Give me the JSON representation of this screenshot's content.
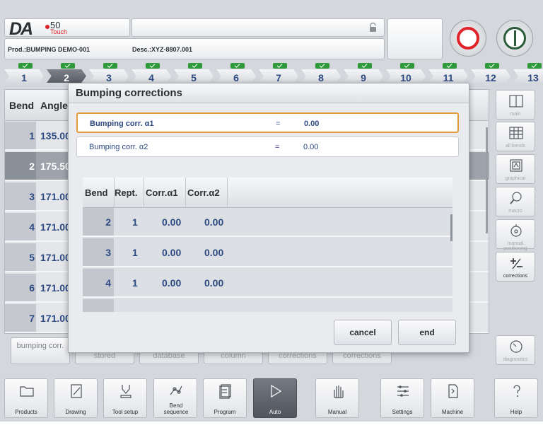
{
  "header": {
    "logo_text": "DA",
    "logo_version": "50",
    "logo_touch": "Touch",
    "product": "Prod.:BUMPING DEMO-001",
    "description": "Desc.:XYZ-8807.001"
  },
  "bend_tabs": [
    "1",
    "2",
    "3",
    "4",
    "5",
    "6",
    "7",
    "8",
    "9",
    "10",
    "11",
    "12",
    "13"
  ],
  "active_bend_tab": 1,
  "bend_table": {
    "col_bend": "Bend",
    "col_angle": "Angle",
    "rows": [
      {
        "bend": "1",
        "angle": "135.00"
      },
      {
        "bend": "2",
        "angle": "175.50"
      },
      {
        "bend": "3",
        "angle": "171.00"
      },
      {
        "bend": "4",
        "angle": "171.00"
      },
      {
        "bend": "5",
        "angle": "171.00"
      },
      {
        "bend": "6",
        "angle": "171.00"
      },
      {
        "bend": "7",
        "angle": "171.00"
      }
    ]
  },
  "side_buttons": [
    {
      "label": "main",
      "icon": "main-view-icon"
    },
    {
      "label": "all bends",
      "icon": "table-icon"
    },
    {
      "label": "graphical",
      "icon": "graphical-icon"
    },
    {
      "label": "macro",
      "icon": "magnifier-icon"
    },
    {
      "label": "manual positioning",
      "icon": "handwheel-icon"
    },
    {
      "label": "corrections",
      "icon": "plus-minus-icon"
    },
    {
      "label": "diagnostics",
      "icon": "diagnostics-icon"
    }
  ],
  "soft_buttons": {
    "bumping": "bumping corr.",
    "stored": "stored",
    "database": "database",
    "column": "column",
    "corrections1": "corrections",
    "corrections2": "corrections"
  },
  "dialog": {
    "title": "Bumping corrections",
    "params": [
      {
        "label": "Bumping corr. α1",
        "eq": "=",
        "value": "0.00"
      },
      {
        "label": "Bumping corr. α2",
        "eq": "=",
        "value": "0.00"
      }
    ],
    "table": {
      "headers": [
        "Bend",
        "Rept.",
        "Corr.α1",
        "Corr.α2"
      ],
      "rows": [
        {
          "bend": "2",
          "rept": "1",
          "c1": "0.00",
          "c2": "0.00"
        },
        {
          "bend": "3",
          "rept": "1",
          "c1": "0.00",
          "c2": "0.00"
        },
        {
          "bend": "4",
          "rept": "1",
          "c1": "0.00",
          "c2": "0.00"
        }
      ]
    },
    "cancel": "cancel",
    "end": "end"
  },
  "toolbar": [
    {
      "label": "Products",
      "icon": "folder-icon"
    },
    {
      "label": "Drawing",
      "icon": "pencil-icon"
    },
    {
      "label": "Tool setup",
      "icon": "tool-icon"
    },
    {
      "label": "Bend sequence",
      "icon": "bend-sequence-icon"
    },
    {
      "label": "Program",
      "icon": "program-icon"
    },
    {
      "label": "Auto",
      "icon": "play-icon"
    },
    {
      "label": "Manual",
      "icon": "hand-icon"
    },
    {
      "label": "Settings",
      "icon": "settings-icon"
    },
    {
      "label": "Machine",
      "icon": "machine-icon"
    },
    {
      "label": "Help",
      "icon": "help-icon"
    }
  ],
  "colors": {
    "accent_blue": "#2d4a83",
    "stop_red": "#e0222a",
    "start_green": "#2a5b3a",
    "focus_orange": "#e39a3c",
    "check_green": "#2f9a3c"
  }
}
